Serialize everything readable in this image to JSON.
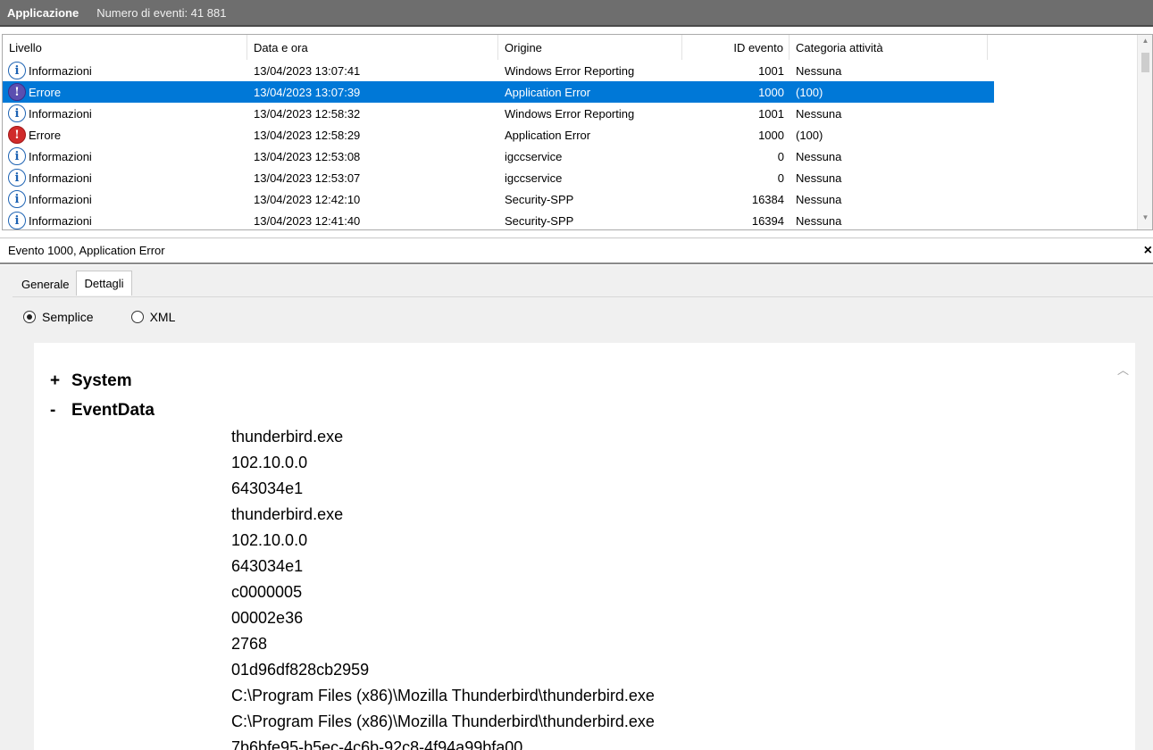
{
  "titlebar": {
    "app": "Applicazione",
    "count": "Numero di eventi: 41 881"
  },
  "list": {
    "headers": [
      "Livello",
      "Data e ora",
      "Origine",
      "ID evento",
      "Categoria attività"
    ],
    "rows": [
      {
        "level": "Informazioni",
        "icon": "info-icon",
        "datetime": "13/04/2023 13:07:41",
        "source": "Windows Error Reporting",
        "id": "1001",
        "category": "Nessuna"
      },
      {
        "level": "Errore",
        "icon": "error-icon",
        "datetime": "13/04/2023 13:07:39",
        "source": "Application Error",
        "id": "1000",
        "category": "(100)",
        "selected": true
      },
      {
        "level": "Informazioni",
        "icon": "info-icon",
        "datetime": "13/04/2023 12:58:32",
        "source": "Windows Error Reporting",
        "id": "1001",
        "category": "Nessuna"
      },
      {
        "level": "Errore",
        "icon": "error-icon",
        "datetime": "13/04/2023 12:58:29",
        "source": "Application Error",
        "id": "1000",
        "category": "(100)"
      },
      {
        "level": "Informazioni",
        "icon": "info-icon",
        "datetime": "13/04/2023 12:53:08",
        "source": "igccservice",
        "id": "0",
        "category": "Nessuna"
      },
      {
        "level": "Informazioni",
        "icon": "info-icon",
        "datetime": "13/04/2023 12:53:07",
        "source": "igccservice",
        "id": "0",
        "category": "Nessuna"
      },
      {
        "level": "Informazioni",
        "icon": "info-icon",
        "datetime": "13/04/2023 12:42:10",
        "source": "Security-SPP",
        "id": "16384",
        "category": "Nessuna"
      },
      {
        "level": "Informazioni",
        "icon": "info-icon",
        "datetime": "13/04/2023 12:41:40",
        "source": "Security-SPP",
        "id": "16394",
        "category": "Nessuna"
      }
    ]
  },
  "detail": {
    "title": "Evento 1000, Application Error",
    "close": "×",
    "tabs": [
      "Generale",
      "Dettagli"
    ],
    "active_tab": "Dettagli",
    "radio_simple": "Semplice",
    "radio_xml": "XML",
    "system_sign": "+",
    "system_label": "System",
    "eventdata_sign": "-",
    "eventdata_label": "EventData",
    "values": [
      "thunderbird.exe",
      "102.10.0.0",
      "643034e1",
      "thunderbird.exe",
      "102.10.0.0",
      "643034e1",
      "c0000005",
      "00002e36",
      "2768",
      "01d96df828cb2959",
      "C:\\Program Files (x86)\\Mozilla Thunderbird\\thunderbird.exe",
      "C:\\Program Files (x86)\\Mozilla Thunderbird\\thunderbird.exe",
      "7b6bfe95-b5ec-4c6b-92c8-4f94a99bfa00"
    ]
  },
  "colors": {
    "selection": "#0078d7",
    "error": "#d02b2b",
    "info": "#1e63b3"
  }
}
